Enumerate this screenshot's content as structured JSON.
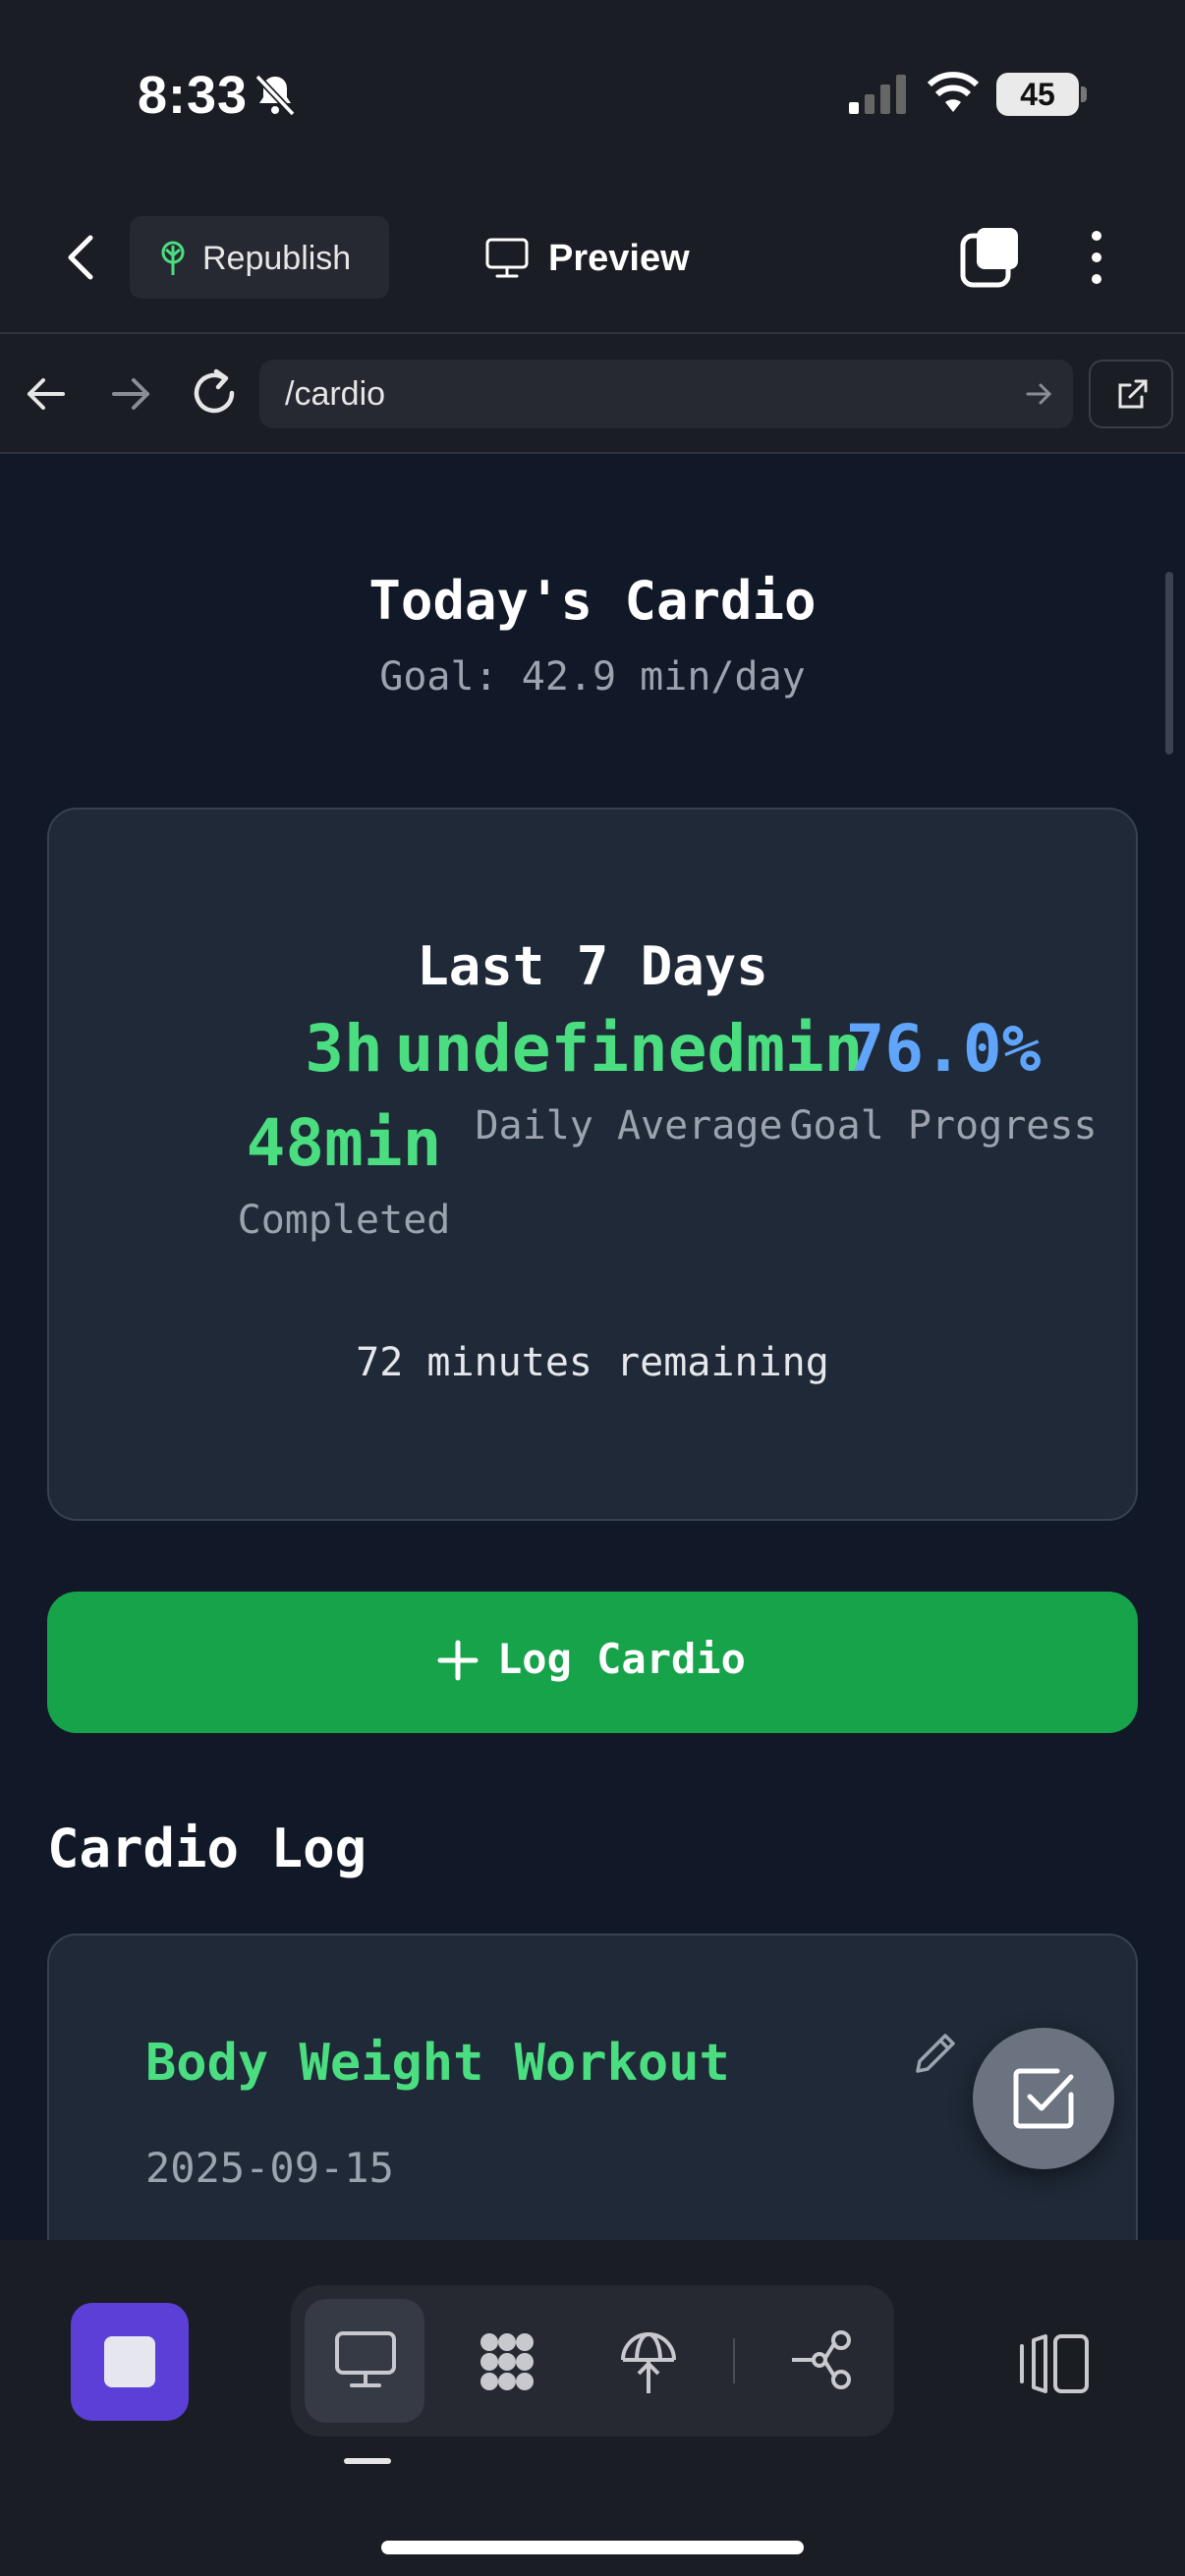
{
  "status": {
    "time": "8:33",
    "battery": "45"
  },
  "toolbar": {
    "republish_label": "Republish",
    "preview_label": "Preview"
  },
  "browser": {
    "url": "/cardio"
  },
  "today": {
    "title": "Today's Cardio",
    "goal": "Goal: 42.9 min/day"
  },
  "stats": {
    "title": "Last 7 Days",
    "completed_value": "3h 48min",
    "completed_label": "Completed",
    "daily_value": "undefinedmin",
    "daily_label": "Daily Average",
    "goal_value": "76.0%",
    "goal_label": "Goal Progress",
    "remaining": "72 minutes remaining"
  },
  "log_button_label": "Log Cardio",
  "log": {
    "heading": "Cardio Log",
    "entries": [
      {
        "title": "Body Weight Workout",
        "date": "2025-09-15"
      }
    ]
  },
  "icons": [
    "bell-slash-icon",
    "signal-icon",
    "wifi-icon",
    "battery-icon",
    "chevron-left-icon",
    "tree-icon",
    "monitor-icon",
    "tabs-icon",
    "more-vertical-icon",
    "arrow-left-icon",
    "arrow-right-icon",
    "reload-icon",
    "external-link-icon",
    "plus-icon",
    "pencil-icon",
    "checkbox-icon",
    "apps-icon",
    "deploy-icon",
    "connect-icon",
    "panel-icon"
  ],
  "colors": {
    "accent_green": "#16a34a",
    "value_green": "#4ade80",
    "value_blue": "#60a5fa",
    "app_purple": "#5b3fd6"
  }
}
